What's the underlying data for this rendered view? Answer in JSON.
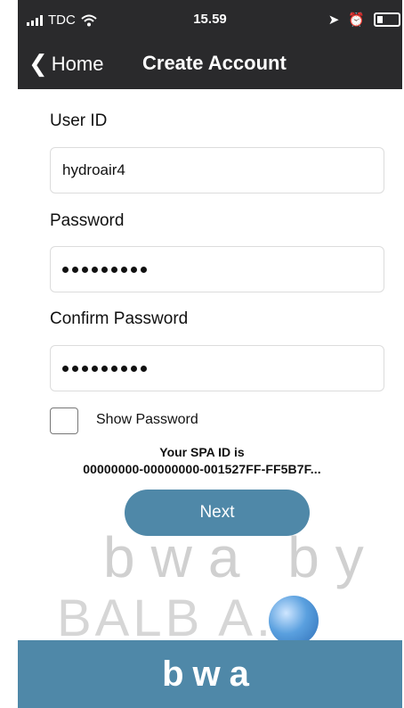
{
  "status_bar": {
    "carrier": "TDC",
    "time": "15.59"
  },
  "nav": {
    "back_label": "Home",
    "title": "Create Account"
  },
  "form": {
    "user_id_label": "User ID",
    "user_id_value": "hydroair4",
    "password_label": "Password",
    "password_masked": "•••••••••",
    "confirm_label": "Confirm Password",
    "confirm_masked": "•••••••••",
    "show_password_label": "Show Password",
    "show_password_checked": false
  },
  "spa": {
    "line1": "Your SPA ID is",
    "line2": "00000000-00000000-001527FF-FF5B7F..."
  },
  "actions": {
    "next_label": "Next"
  },
  "branding": {
    "watermark_line1": "bwa by",
    "watermark_line2": "BALB A.",
    "footer_logo": "bwa",
    "footer_color": "#4f88a8"
  }
}
